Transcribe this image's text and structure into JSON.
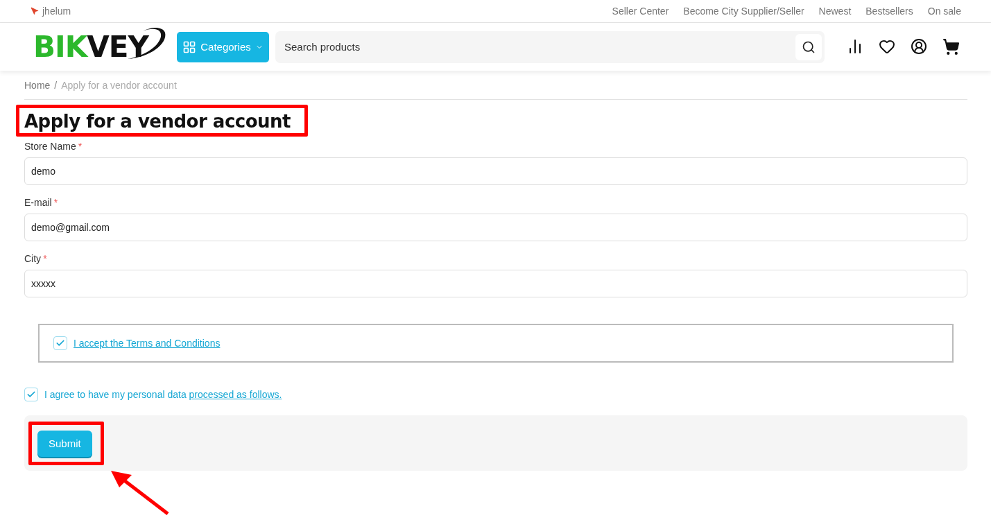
{
  "top_bar": {
    "location": "jhelum",
    "links": [
      "Seller Center",
      "Become City Supplier/Seller",
      "Newest",
      "Bestsellers",
      "On sale"
    ]
  },
  "header": {
    "logo": [
      {
        "text": "BIK",
        "kind": "accent"
      },
      {
        "text": "VEY",
        "kind": "base"
      }
    ],
    "categories_button": "Categories",
    "search": {
      "placeholder": "Search products"
    }
  },
  "breadcrumb_separator": "/",
  "required_mark": "*",
  "breadcrumb": [
    {
      "label": "Home",
      "selected": false
    },
    {
      "label": "Apply for a vendor account",
      "selected": true
    }
  ],
  "title": "Apply for a vendor account",
  "fields": [
    {
      "label": "Store Name",
      "required": true,
      "value": "demo"
    },
    {
      "label": "E-mail",
      "required": true,
      "value": "demo@gmail.com"
    },
    {
      "label": "City",
      "required": true,
      "value": "xxxxx"
    }
  ],
  "terms": {
    "checked": true,
    "link": "I accept the Terms and Conditions"
  },
  "consent": {
    "checked": true,
    "text": "I agree to have my personal data",
    "link": "processed as follows."
  },
  "submit_button": "Submit"
}
